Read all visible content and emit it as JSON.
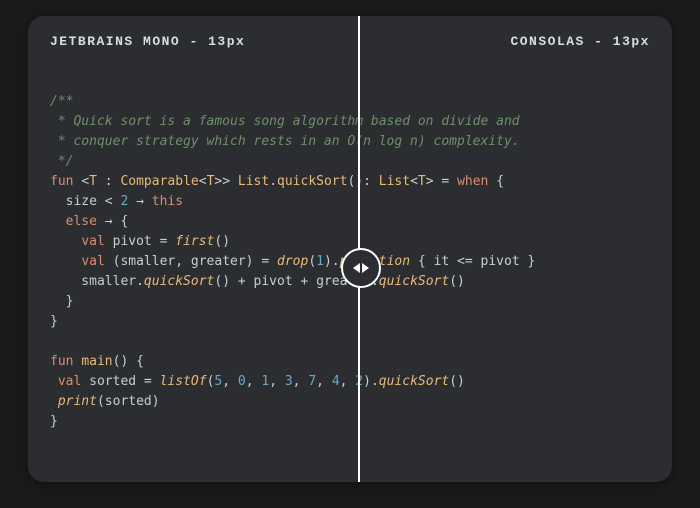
{
  "header": {
    "left_font": "JETBRAINS MONO",
    "left_size": "13px",
    "right_font": "CONSOLAS",
    "right_size": "13px",
    "sep": " - "
  },
  "code": {
    "c1": "/**",
    "c2": " * Quick sort is a famous song algorithm based on divide and",
    "c3": " * conquer strategy which rests in an O(n log n) complexity.",
    "c4": " */",
    "fun": "fun",
    "lt": "<",
    "T": "T",
    "colon": " : ",
    "Comparable": "Comparable",
    "gt": ">",
    "gtgt": ">>",
    "space": " ",
    "List": "List",
    "dot": ".",
    "quickSort": "quickSort",
    "parens": "()",
    "ret_colon": ": ",
    "eq": " = ",
    "when": "when",
    "lbrace": " {",
    "size": "  size",
    "lt2": " < ",
    "two": "2",
    "arrow": " → ",
    "this": "this",
    "else": "  else",
    "lbrace2": "{",
    "valkw": "val",
    "pivot": " pivot",
    "eq2": " = ",
    "first": "first",
    "destruct_open": " (smaller, greater)",
    "drop": "drop",
    "one": "1",
    "rparen": ")",
    "partition": "partition",
    "lbrace3": " { ",
    "it": "it",
    "le": " <= ",
    "pivot2": "pivot",
    "rbrace3": " }",
    "smaller": "    smaller",
    "plus": " + ",
    "pivot3": "pivot",
    "greater": "greater",
    "rbrace": "  }",
    "rbrace_outer": "}",
    "main": "main",
    "sorted": " sorted",
    "listOf": "listOf",
    "lparen": "(",
    "n5": "5",
    "comma": ", ",
    "n0": "0",
    "n1": "1",
    "n3": "3",
    "n7": "7",
    "n4": "4",
    "n2": "2",
    "print": "print",
    "sorted2": "(sorted)",
    "indent4": "    ",
    "indent1": " "
  },
  "handle": {
    "left_icon": "chevron-left",
    "right_icon": "chevron-right"
  }
}
